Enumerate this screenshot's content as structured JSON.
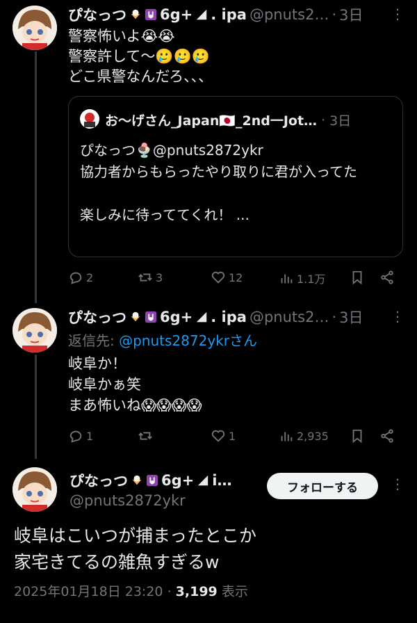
{
  "tweet1": {
    "name": "ぴなっつ",
    "badge": "6g+",
    "name_suffix": ". ipa",
    "handle": "@pnuts2…",
    "dot": "·",
    "time": "3日",
    "body": "警察怖いよ😭😭\n警察許して〜🥲🥲🥲\nどこ県警なんだろ、、、",
    "quote": {
      "name": "お〜げさん_Japan🇯🇵_2nd一Jot…",
      "dot": "·",
      "time": "3日",
      "body": "ぴなっつ🍨@pnuts2872ykr\n協力者からもらったやり取りに君が入ってた\n\n楽しみに待っててくれ！ ..."
    },
    "actions": {
      "reply": "2",
      "retweet": "3",
      "like": "12",
      "views": "1.1万"
    }
  },
  "tweet2": {
    "name": "ぴなっつ",
    "badge": "6g+",
    "name_suffix": ". ipa",
    "handle": "@pnuts2…",
    "dot": "·",
    "time": "3日",
    "reply_prefix": "返信先: ",
    "reply_to": "@pnuts2872ykrさん",
    "body": "岐阜か！\n岐阜かぁ笑\nまあ怖いね😱😱😱😱",
    "actions": {
      "reply": "1",
      "retweet": "",
      "like": "1",
      "views": "2,935"
    }
  },
  "tweet3": {
    "name": "ぴなっつ",
    "badge": "6g+",
    "name_suffix": "i…",
    "handle": "@pnuts2872ykr",
    "follow_label": "フォローする",
    "body": "岐阜はこいつが捕まったとこか\n家宅きてるの雑魚すぎるw",
    "timestamp": "2025年01月18日 23:20",
    "dot": "·",
    "views_count": "3,199",
    "views_label": "表示"
  },
  "colors": {
    "background": "#000000",
    "text": "#e7e9ea",
    "muted": "#71767b",
    "link": "#1d9bf0",
    "border": "#2f3336"
  }
}
